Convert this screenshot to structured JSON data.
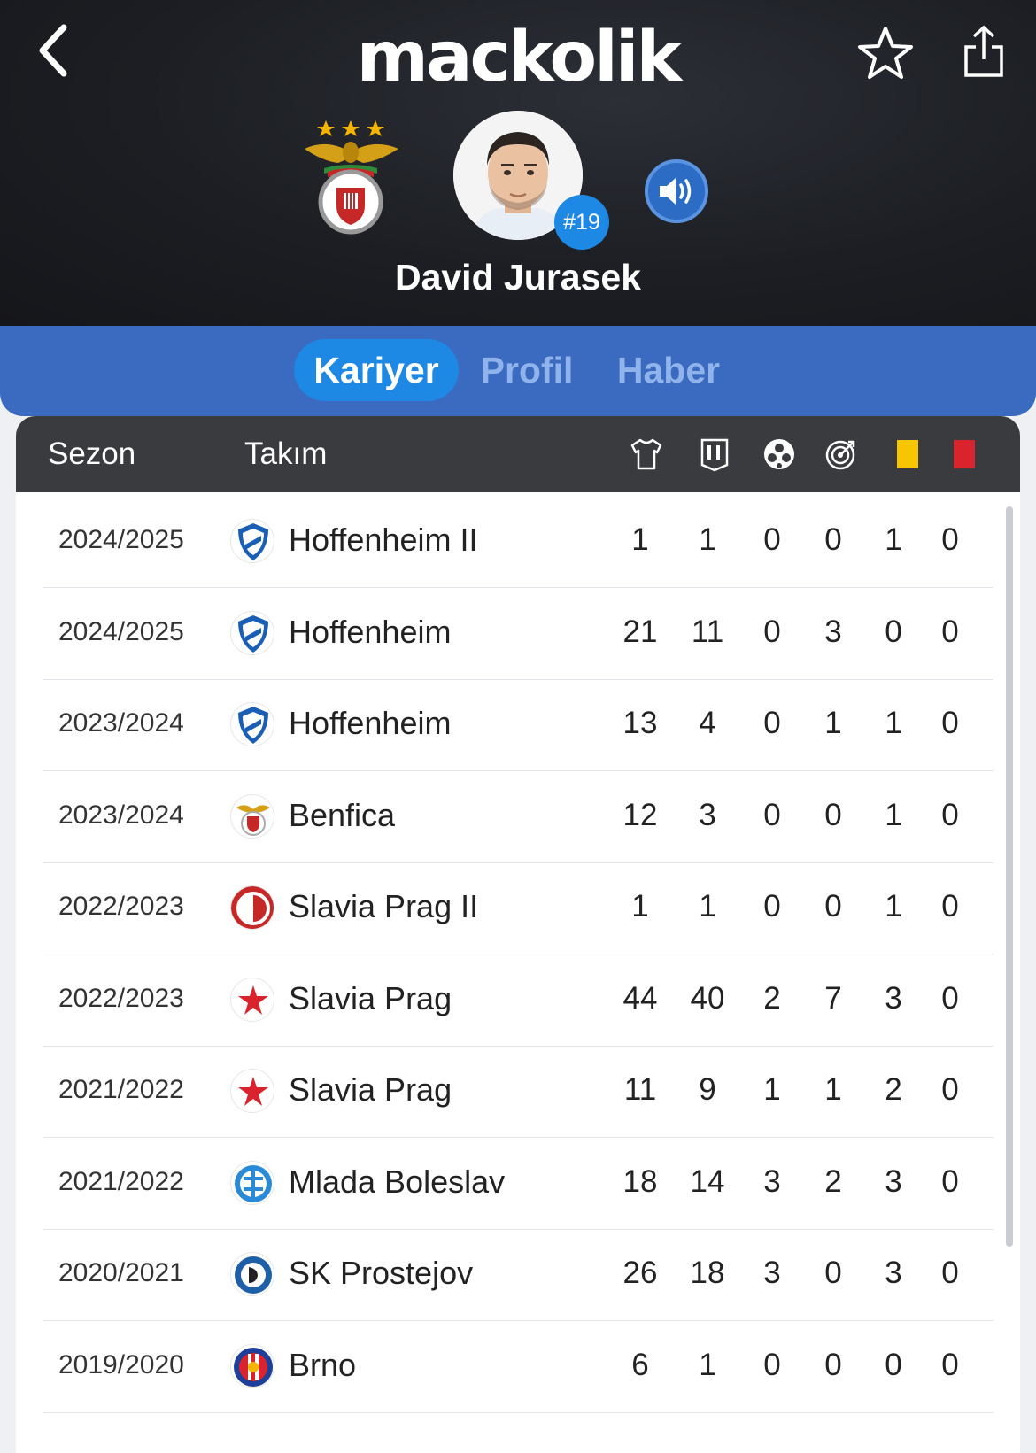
{
  "header": {
    "brand": "mackolik",
    "player_name": "David Jurasek",
    "shirt_number": "#19",
    "icons": {
      "back": "chevron-left-icon",
      "favorite": "star-outline-icon",
      "share": "share-icon",
      "audio": "speaker-icon",
      "club": "benfica-crest"
    }
  },
  "tabs": [
    {
      "label": "Kariyer",
      "active": true
    },
    {
      "label": "Profil",
      "active": false
    },
    {
      "label": "Haber",
      "active": false
    }
  ],
  "table": {
    "headers": {
      "season": "Sezon",
      "team": "Takım",
      "stat_icons": [
        "shirt-icon",
        "lineup-icon",
        "ball-icon",
        "target-icon",
        "yellow-card-icon",
        "red-card-icon"
      ]
    },
    "colors": {
      "yellow_card": "#f7c600",
      "red_card": "#d9232d",
      "header_bg": "#3a3b3e",
      "accent": "#1e88e5"
    },
    "rows": [
      {
        "season": "2024/2025",
        "team": "Hoffenheim II",
        "logo": "hoffenheim",
        "stats": [
          "1",
          "1",
          "0",
          "0",
          "1",
          "0"
        ]
      },
      {
        "season": "2024/2025",
        "team": "Hoffenheim",
        "logo": "hoffenheim",
        "stats": [
          "21",
          "11",
          "0",
          "3",
          "0",
          "0"
        ]
      },
      {
        "season": "2023/2024",
        "team": "Hoffenheim",
        "logo": "hoffenheim",
        "stats": [
          "13",
          "4",
          "0",
          "1",
          "1",
          "0"
        ]
      },
      {
        "season": "2023/2024",
        "team": "Benfica",
        "logo": "benfica",
        "stats": [
          "12",
          "3",
          "0",
          "0",
          "1",
          "0"
        ]
      },
      {
        "season": "2022/2023",
        "team": "Slavia Prag II",
        "logo": "slavia-ring",
        "stats": [
          "1",
          "1",
          "0",
          "0",
          "1",
          "0"
        ]
      },
      {
        "season": "2022/2023",
        "team": "Slavia Prag",
        "logo": "slavia-star",
        "stats": [
          "44",
          "40",
          "2",
          "7",
          "3",
          "0"
        ]
      },
      {
        "season": "2021/2022",
        "team": "Slavia Prag",
        "logo": "slavia-star",
        "stats": [
          "11",
          "9",
          "1",
          "1",
          "2",
          "0"
        ]
      },
      {
        "season": "2021/2022",
        "team": "Mlada Boleslav",
        "logo": "mlada",
        "stats": [
          "18",
          "14",
          "3",
          "2",
          "3",
          "0"
        ]
      },
      {
        "season": "2020/2021",
        "team": "SK Prostejov",
        "logo": "prostejov",
        "stats": [
          "26",
          "18",
          "3",
          "0",
          "3",
          "0"
        ]
      },
      {
        "season": "2019/2020",
        "team": "Brno",
        "logo": "brno",
        "stats": [
          "6",
          "1",
          "0",
          "0",
          "0",
          "0"
        ]
      }
    ]
  }
}
